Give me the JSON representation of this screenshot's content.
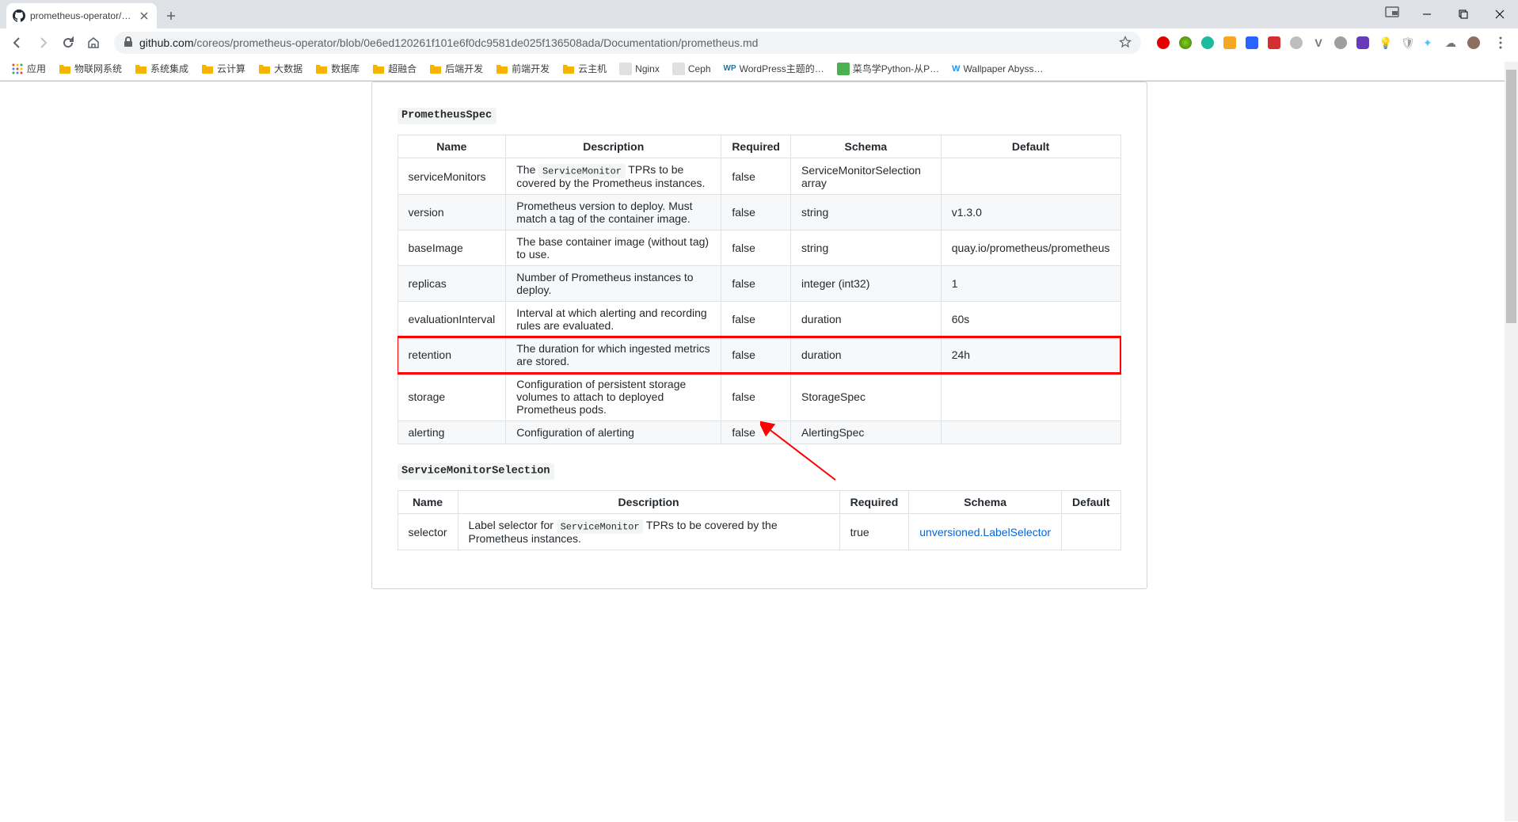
{
  "browser": {
    "tab_title": "prometheus-operator/promet",
    "url_host": "github.com",
    "url_path": "/coreos/prometheus-operator/blob/0e6ed120261f101e6f0dc9581de025f136508ada/Documentation/prometheus.md"
  },
  "bookmarks": [
    {
      "type": "apps",
      "label": "应用"
    },
    {
      "type": "folder",
      "label": "物联网系统"
    },
    {
      "type": "folder",
      "label": "系统集成"
    },
    {
      "type": "folder",
      "label": "云计算"
    },
    {
      "type": "folder",
      "label": "大数据"
    },
    {
      "type": "folder",
      "label": "数据库"
    },
    {
      "type": "folder",
      "label": "超融合"
    },
    {
      "type": "folder",
      "label": "后端开发"
    },
    {
      "type": "folder",
      "label": "前端开发"
    },
    {
      "type": "folder",
      "label": "云主机"
    },
    {
      "type": "link",
      "label": "Nginx"
    },
    {
      "type": "link",
      "label": "Ceph"
    },
    {
      "type": "wp",
      "label": "WordPress主题的…"
    },
    {
      "type": "cn",
      "label": "菜鸟学Python-从P…"
    },
    {
      "type": "wa",
      "label": "Wallpaper Abyss…"
    }
  ],
  "section1": {
    "heading": "PrometheusSpec",
    "headers": [
      "Name",
      "Description",
      "Required",
      "Schema",
      "Default"
    ],
    "rows": [
      {
        "name": "serviceMonitors",
        "desc_pre": "The ",
        "desc_code": "ServiceMonitor",
        "desc_post": " TPRs to be covered by the Prometheus instances.",
        "required": "false",
        "schema": "ServiceMonitorSelection array",
        "default": ""
      },
      {
        "name": "version",
        "desc": "Prometheus version to deploy. Must match a tag of the container image.",
        "required": "false",
        "schema": "string",
        "default": "v1.3.0"
      },
      {
        "name": "baseImage",
        "desc": "The base container image (without tag) to use.",
        "required": "false",
        "schema": "string",
        "default": "quay.io/prometheus/prometheus"
      },
      {
        "name": "replicas",
        "desc": "Number of Prometheus instances to deploy.",
        "required": "false",
        "schema": "integer (int32)",
        "default": "1"
      },
      {
        "name": "evaluationInterval",
        "desc": "Interval at which alerting and recording rules are evaluated.",
        "required": "false",
        "schema": "duration",
        "default": "60s"
      },
      {
        "name": "retention",
        "desc": "The duration for which ingested metrics are stored.",
        "required": "false",
        "schema": "duration",
        "default": "24h",
        "highlight": true
      },
      {
        "name": "storage",
        "desc": "Configuration of persistent storage volumes to attach to deployed Prometheus pods.",
        "required": "false",
        "schema": "StorageSpec",
        "default": ""
      },
      {
        "name": "alerting",
        "desc": "Configuration of alerting",
        "required": "false",
        "schema": "AlertingSpec",
        "default": ""
      }
    ]
  },
  "section2": {
    "heading": "ServiceMonitorSelection",
    "headers": [
      "Name",
      "Description",
      "Required",
      "Schema",
      "Default"
    ],
    "rows": [
      {
        "name": "selector",
        "desc_pre": "Label selector for ",
        "desc_code": "ServiceMonitor",
        "desc_post": " TPRs to be covered by the Prometheus instances.",
        "required": "true",
        "schema": "unversioned.LabelSelector",
        "schema_link": true,
        "default": ""
      }
    ]
  }
}
